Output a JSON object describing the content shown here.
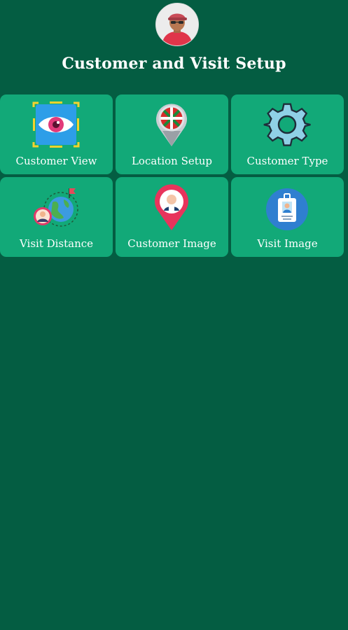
{
  "header": {
    "title": "Customer and Visit Setup"
  },
  "menu": {
    "items": [
      {
        "label": "Customer View",
        "icon": "eye-icon"
      },
      {
        "label": "Location Setup",
        "icon": "location-pin-flag-icon"
      },
      {
        "label": "Customer Type",
        "icon": "gear-icon"
      },
      {
        "label": "Visit Distance",
        "icon": "globe-distance-icon"
      },
      {
        "label": "Customer Image",
        "icon": "customer-pin-icon"
      },
      {
        "label": "Visit Image",
        "icon": "id-badge-icon"
      }
    ]
  },
  "colors": {
    "background": "#045d42",
    "tile": "#12a978",
    "text": "#ffffff"
  }
}
